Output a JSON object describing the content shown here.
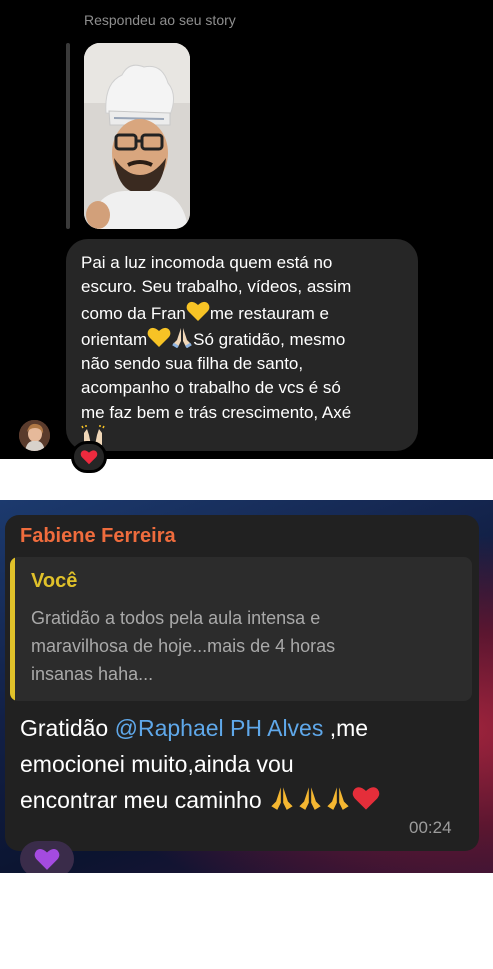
{
  "instagram": {
    "header": "Respondeu ao seu story",
    "message": {
      "line1": "Pai a luz incomoda quem está no",
      "line2": "escuro. Seu trabalho, vídeos, assim",
      "line3_a": "como da Fran",
      "line3_b": "me restauram e",
      "line4_a": "orientam",
      "line4_b": "Só gratidão, mesmo",
      "line5": "não sendo sua filha de santo,",
      "line6": "acompanho o trabalho de vcs é só",
      "line7": "me faz bem e trás crescimento, Axé"
    },
    "reaction_icon": "red-heart-icon"
  },
  "telegram": {
    "sender": "Fabiene Ferreira",
    "reply": {
      "name": "Você",
      "line1": "Gratidão a todos pela aula intensa e",
      "line2": "maravilhosa de hoje...mais de 4 horas",
      "line3": "insanas haha..."
    },
    "message": {
      "prefix": "Gratidão ",
      "mention": "@Raphael PH Alves",
      "line1_suffix": " ,me",
      "line2": "emocionei muito,ainda vou",
      "line3": "encontrar meu caminho "
    },
    "time": "00:24",
    "reaction_icon": "purple-heart-icon",
    "colors": {
      "sender": "#ef6c3d",
      "reply_accent": "#e0c12a",
      "mention": "#5fa8ea"
    }
  }
}
